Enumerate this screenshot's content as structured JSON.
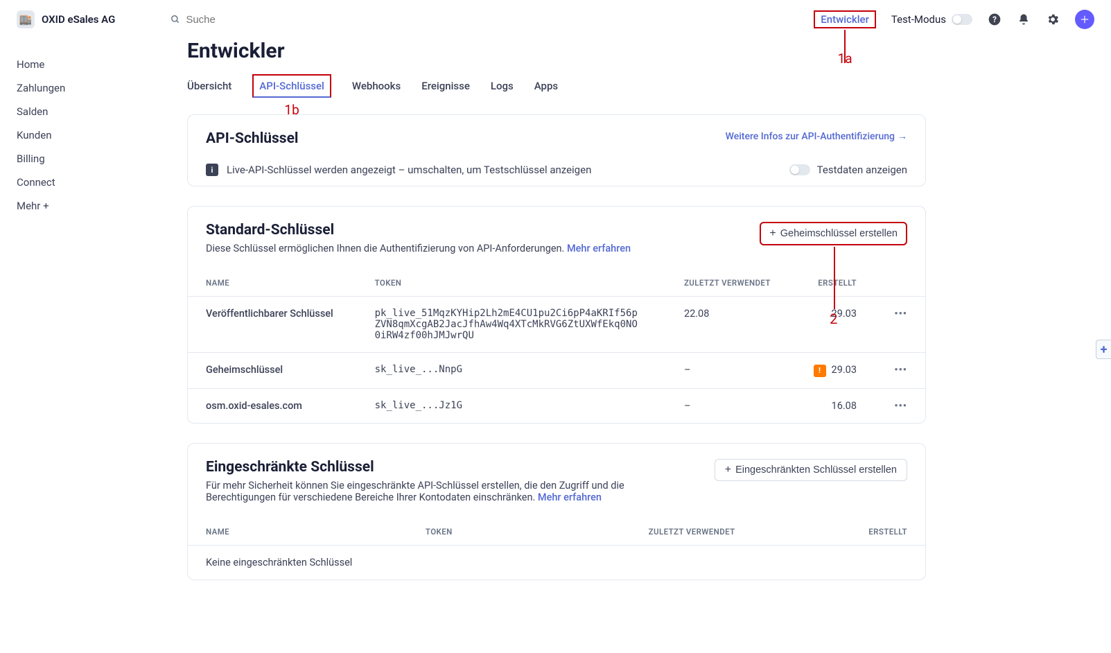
{
  "brand": {
    "name": "OXID eSales AG"
  },
  "search": {
    "placeholder": "Suche"
  },
  "top_links": {
    "entwickler": "Entwickler",
    "testmodus": "Test-Modus"
  },
  "annotations": {
    "a1": "1a",
    "b1": "1b",
    "a2": "2"
  },
  "sidebar": {
    "items": [
      {
        "label": "Home"
      },
      {
        "label": "Zahlungen"
      },
      {
        "label": "Salden"
      },
      {
        "label": "Kunden"
      },
      {
        "label": "Billing"
      },
      {
        "label": "Connect"
      },
      {
        "label": "Mehr +"
      }
    ]
  },
  "page": {
    "title": "Entwickler"
  },
  "tabs": [
    {
      "label": "Übersicht"
    },
    {
      "label": "API-Schlüssel",
      "active": true
    },
    {
      "label": "Webhooks"
    },
    {
      "label": "Ereignisse"
    },
    {
      "label": "Logs"
    },
    {
      "label": "Apps"
    }
  ],
  "api_card": {
    "title": "API-Schlüssel",
    "more_link": "Weitere Infos zur API-Authentifizierung",
    "info_text": "Live-API-Schlüssel werden angezeigt – umschalten, um Testschlüssel anzeigen",
    "testdaten_label": "Testdaten anzeigen"
  },
  "standard_section": {
    "title": "Standard-Schlüssel",
    "desc": "Diese Schlüssel ermöglichen Ihnen die Authentifizierung von API-Anforderungen. ",
    "more": "Mehr erfahren",
    "create_btn": "Geheimschlüssel erstellen",
    "columns": {
      "name": "NAME",
      "token": "TOKEN",
      "last_used": "ZULETZT VERWENDET",
      "created": "ERSTELLT"
    },
    "rows": [
      {
        "name": "Veröffentlichbarer Schlüssel",
        "token": "pk_live_51MqzKYHip2Lh2mE4CU1pu2Ci6pP4aKRIf56pZVN8qmXcgAB2JacJfhAw4Wq4XTcMkRVG6ZtUXWfEkq0NO0iRW4zf00hJMJwrQU",
        "last_used": "22.08",
        "created": "29.03",
        "warn": false
      },
      {
        "name": "Geheimschlüssel",
        "token": "sk_live_...NnpG",
        "last_used": "–",
        "created": "29.03",
        "warn": true
      },
      {
        "name": "osm.oxid-esales.com",
        "token": "sk_live_...Jz1G",
        "last_used": "–",
        "created": "16.08",
        "warn": false
      }
    ]
  },
  "restricted_section": {
    "title": "Eingeschränkte Schlüssel",
    "desc": "Für mehr Sicherheit können Sie eingeschränkte API-Schlüssel erstellen, die den Zugriff und die Berechtigungen für verschiedene Bereiche Ihrer Kontodaten einschränken. ",
    "more": "Mehr erfahren",
    "create_btn": "Eingeschränkten Schlüssel erstellen",
    "columns": {
      "name": "NAME",
      "token": "TOKEN",
      "last_used": "ZULETZT VERWENDET",
      "created": "ERSTELLT"
    },
    "empty": "Keine eingeschränkten Schlüssel"
  }
}
